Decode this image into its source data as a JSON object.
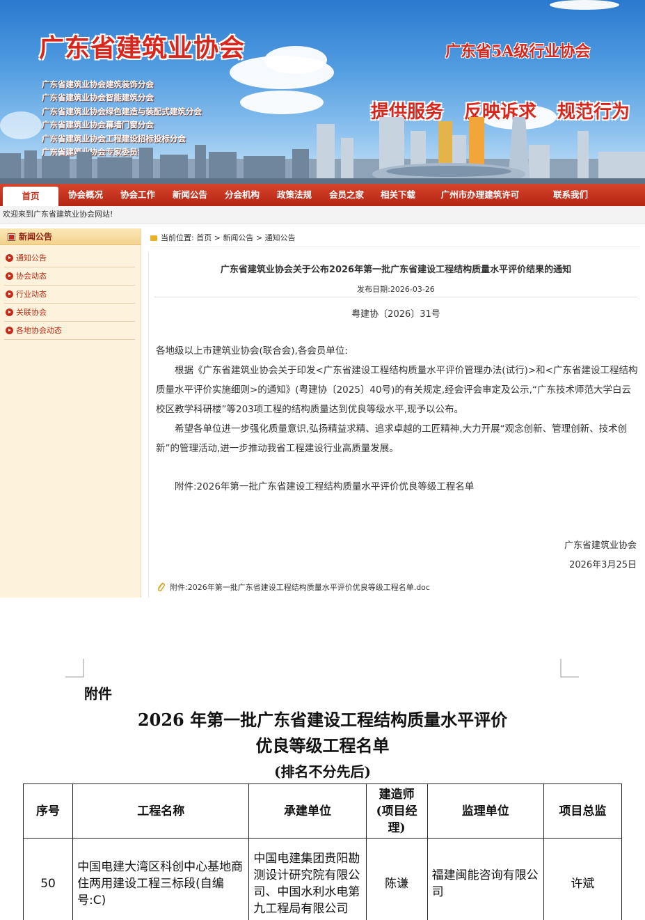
{
  "banner": {
    "site_title": "广东省建筑业协会",
    "branches": [
      "广东省建筑业协会建筑装饰分会",
      "广东省建筑业协会智能建筑分会",
      "广东省建筑业协会绿色建造与装配式建筑分会",
      "广东省建筑业协会幕墙门窗分会",
      "广东省建筑业协会工程建设招标投标分会",
      "广东省建筑业协会专家委员会"
    ],
    "grade_text": "广东省5A级行业协会",
    "slogans": [
      "提供服务",
      "反映诉求",
      "规范行为"
    ]
  },
  "nav": {
    "items": [
      "首页",
      "协会概况",
      "协会工作",
      "新闻公告",
      "分会机构",
      "政策法规",
      "会员之家",
      "相关下载",
      "广州市办理建筑许可",
      "联系我们"
    ]
  },
  "welcome": "欢迎来到广东省建筑业协会网站!",
  "sidebar": {
    "heading": "新闻公告",
    "items": [
      "通知公告",
      "协会动态",
      "行业动态",
      "关联协会",
      "各地协会动态"
    ]
  },
  "breadcrumb": {
    "label": "当前位置:",
    "home": "首页",
    "sep1": ">",
    "section": "新闻公告",
    "sep2": ">",
    "current": "通知公告"
  },
  "article": {
    "title": "广东省建筑业协会关于公布2026年第一批广东省建设工程结构质量水平评价结果的通知",
    "date": "发布日期:2026-03-26",
    "doc_no": "粤建协〔2026〕31号",
    "salutation": "各地级以上市建筑业协会(联合会),各会员单位:",
    "para1": "根据《广东省建筑业协会关于印发<广东省建设工程结构质量水平评价管理办法(试行)>和<广东省建设工程结构质量水平评价实施细则>的通知》(粤建协〔2025〕40号)的有关规定,经会评会审定及公示,“广东技术师范大学白云校区教学科研楼”等203项工程的结构质量达到优良等级水平,现予以公布。",
    "para2": "希望各单位进一步强化质量意识,弘扬精益求精、追求卓越的工匠精神,大力开展“观念创新、管理创新、技术创新”的管理活动,进一步推动我省工程建设行业高质量发展。",
    "attachment_note": "附件:2026年第一批广东省建设工程结构质量水平评价优良等级工程名单",
    "signer": "广东省建筑业协会",
    "sign_date": "2026年3月25日",
    "attachment_file": "附件:2026年第一批广东省建设工程结构质量水平评价优良等级工程名单.doc"
  },
  "doc_preview": {
    "label": "附件",
    "title_line1": "2026 年第一批广东省建设工程结构质量水平评价",
    "title_line2": "优良等级工程名单",
    "subtitle": "(排名不分先后)",
    "table": {
      "headers": [
        "序号",
        "工程名称",
        "承建单位",
        "建造师(项目经理)",
        "监理单位",
        "项目总监"
      ],
      "rows": [
        [
          "50",
          "中国电建大湾区科创中心基地商住两用建设工程三标段(自编号:C)",
          "中国电建集团贵阳勘测设计研究院有限公司、中国水利水电第九工程局有限公司",
          "陈谦",
          "福建闽能咨询有限公司",
          "许斌"
        ]
      ]
    }
  },
  "colors": {
    "nav_red": "#c62d18",
    "title_red": "#d9261c",
    "sidebar_bg": "#fdf3dd"
  }
}
